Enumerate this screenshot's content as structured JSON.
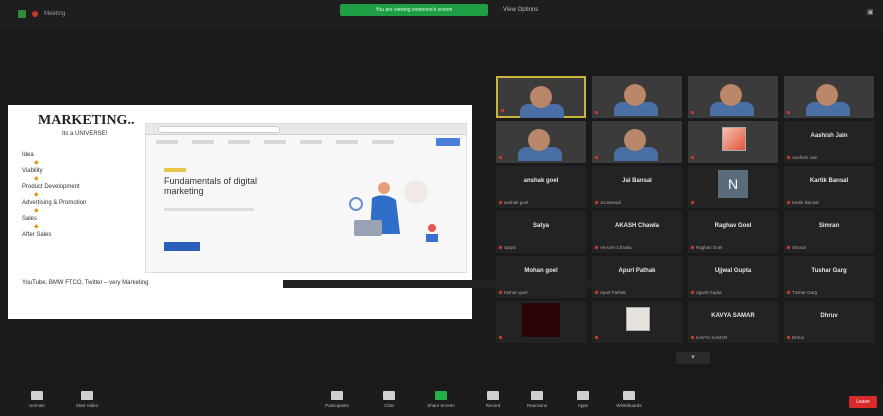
{
  "topbar": {
    "meeting_label": "Meeting",
    "share_banner": "You are viewing someone's screen",
    "view_options": "View Options"
  },
  "slide": {
    "title": "MARKETING..",
    "subtitle": "Its a UNIVERSE!",
    "list": [
      "Idea",
      "Viability",
      "Product Development",
      "Advertising & Promotion",
      "Sales",
      "After Sales"
    ],
    "footer": "YouTube, BMW FTCO, Twitter – very Marketing",
    "course_title": "Fundamentals of digital marketing"
  },
  "gallery": {
    "tiles": [
      {
        "type": "video",
        "label": "",
        "name": "",
        "active": true
      },
      {
        "type": "video",
        "label": "",
        "name": ""
      },
      {
        "type": "video",
        "label": "",
        "name": ""
      },
      {
        "type": "video",
        "label": "",
        "name": ""
      },
      {
        "type": "video",
        "label": "",
        "name": ""
      },
      {
        "type": "video",
        "label": "",
        "name": ""
      },
      {
        "type": "image",
        "label": "",
        "name": ""
      },
      {
        "type": "name",
        "label": "Aashish Jain",
        "name": "Aashish Jain"
      },
      {
        "type": "name",
        "label": "anshak goel",
        "name": "anshak goel"
      },
      {
        "type": "name",
        "label": "Jai Bansal",
        "name": "Jai Bansal"
      },
      {
        "type": "avatar-n",
        "label": "",
        "name": ""
      },
      {
        "type": "name",
        "label": "Kartik Bansal",
        "name": "Kartik Bansal"
      },
      {
        "type": "name",
        "label": "Satya",
        "name": "Satya"
      },
      {
        "type": "name",
        "label": "AKASH Chawla",
        "name": "AKASH Chawla"
      },
      {
        "type": "name",
        "label": "Raghav Goel",
        "name": "Raghav Goel"
      },
      {
        "type": "name",
        "label": "Simran",
        "name": "Simran"
      },
      {
        "type": "name",
        "label": "Mohan goel",
        "name": "Mohan goel"
      },
      {
        "type": "name",
        "label": "Apurl Pathak",
        "name": "Apurl Pathak"
      },
      {
        "type": "name",
        "label": "Ujjwal Gupta",
        "name": "Ujjwal Gupta"
      },
      {
        "type": "name",
        "label": "Tushar Garg",
        "name": "Tushar Garg"
      },
      {
        "type": "dark",
        "label": "",
        "name": ""
      },
      {
        "type": "photo",
        "label": "",
        "name": ""
      },
      {
        "type": "name",
        "label": "KAVYA SAMAR",
        "name": "KAVYA SAMAR"
      },
      {
        "type": "name",
        "label": "Dhruv",
        "name": "Dhruv"
      }
    ]
  },
  "toolbar": {
    "items": [
      {
        "label": "Unmute",
        "icon": "microphone-icon"
      },
      {
        "label": "Start Video",
        "icon": "video-camera-icon"
      },
      {
        "label": "Participants",
        "icon": "participants-icon"
      },
      {
        "label": "Chat",
        "icon": "chat-icon"
      },
      {
        "label": "Share Screen",
        "icon": "share-screen-icon"
      },
      {
        "label": "Record",
        "icon": "record-icon"
      },
      {
        "label": "Reactions",
        "icon": "reactions-icon"
      },
      {
        "label": "Apps",
        "icon": "apps-icon"
      },
      {
        "label": "Whiteboards",
        "icon": "whiteboard-icon"
      }
    ],
    "end_label": "Leave"
  },
  "colors": {
    "share_banner": "#1f9d45",
    "end_button": "#d92b2b",
    "active_speaker": "#c9b53a",
    "background": "#1a1a1a"
  }
}
